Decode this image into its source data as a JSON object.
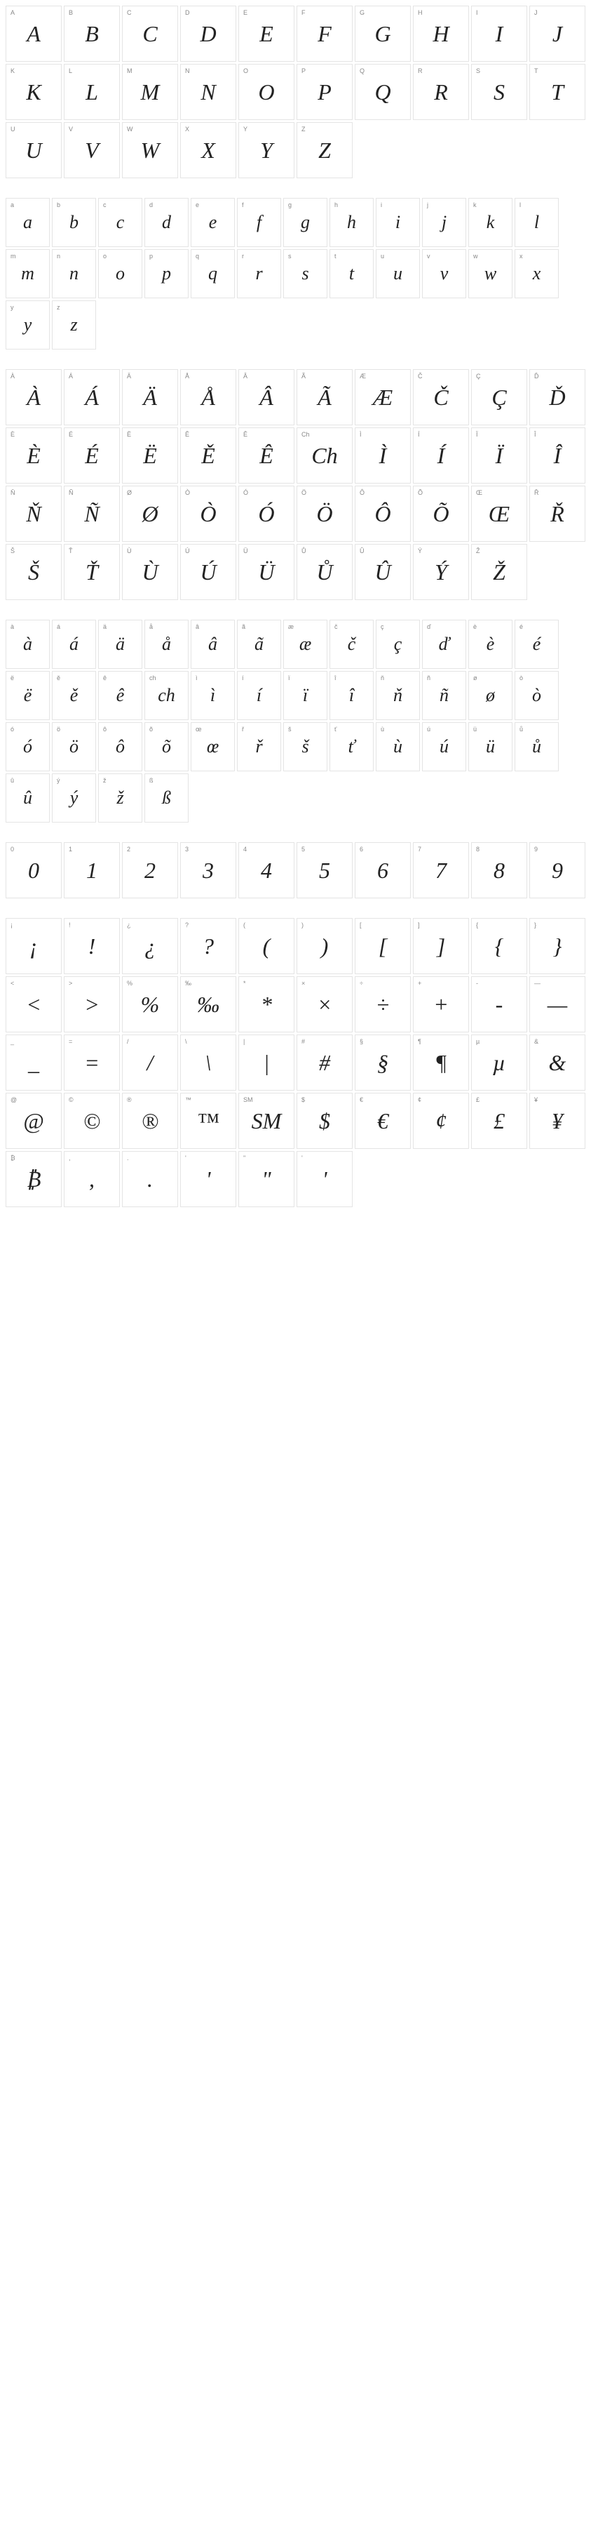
{
  "groups": [
    {
      "size": "lg",
      "cells": [
        {
          "l": "A",
          "g": "A"
        },
        {
          "l": "B",
          "g": "B"
        },
        {
          "l": "C",
          "g": "C"
        },
        {
          "l": "D",
          "g": "D"
        },
        {
          "l": "E",
          "g": "E"
        },
        {
          "l": "F",
          "g": "F"
        },
        {
          "l": "G",
          "g": "G"
        },
        {
          "l": "H",
          "g": "H"
        },
        {
          "l": "I",
          "g": "I"
        },
        {
          "l": "J",
          "g": "J"
        },
        {
          "l": "K",
          "g": "K"
        },
        {
          "l": "L",
          "g": "L"
        },
        {
          "l": "M",
          "g": "M"
        },
        {
          "l": "N",
          "g": "N"
        },
        {
          "l": "O",
          "g": "O"
        },
        {
          "l": "P",
          "g": "P"
        },
        {
          "l": "Q",
          "g": "Q"
        },
        {
          "l": "R",
          "g": "R"
        },
        {
          "l": "S",
          "g": "S"
        },
        {
          "l": "T",
          "g": "T"
        },
        {
          "l": "U",
          "g": "U"
        },
        {
          "l": "V",
          "g": "V"
        },
        {
          "l": "W",
          "g": "W"
        },
        {
          "l": "X",
          "g": "X"
        },
        {
          "l": "Y",
          "g": "Y"
        },
        {
          "l": "Z",
          "g": "Z"
        }
      ]
    },
    {
      "size": "sm",
      "cells": [
        {
          "l": "a",
          "g": "a"
        },
        {
          "l": "b",
          "g": "b"
        },
        {
          "l": "c",
          "g": "c"
        },
        {
          "l": "d",
          "g": "d"
        },
        {
          "l": "e",
          "g": "e"
        },
        {
          "l": "f",
          "g": "f"
        },
        {
          "l": "g",
          "g": "g"
        },
        {
          "l": "h",
          "g": "h"
        },
        {
          "l": "i",
          "g": "i"
        },
        {
          "l": "j",
          "g": "j"
        },
        {
          "l": "k",
          "g": "k"
        },
        {
          "l": "l",
          "g": "l"
        },
        {
          "l": "m",
          "g": "m"
        },
        {
          "l": "n",
          "g": "n"
        },
        {
          "l": "o",
          "g": "o"
        },
        {
          "l": "p",
          "g": "p"
        },
        {
          "l": "q",
          "g": "q"
        },
        {
          "l": "r",
          "g": "r"
        },
        {
          "l": "s",
          "g": "s"
        },
        {
          "l": "t",
          "g": "t"
        },
        {
          "l": "u",
          "g": "u"
        },
        {
          "l": "v",
          "g": "v"
        },
        {
          "l": "w",
          "g": "w"
        },
        {
          "l": "x",
          "g": "x"
        },
        {
          "l": "y",
          "g": "y"
        },
        {
          "l": "z",
          "g": "z"
        }
      ]
    },
    {
      "size": "lg",
      "cells": [
        {
          "l": "À",
          "g": "À"
        },
        {
          "l": "Á",
          "g": "Á"
        },
        {
          "l": "Ä",
          "g": "Ä"
        },
        {
          "l": "Å",
          "g": "Å"
        },
        {
          "l": "Â",
          "g": "Â"
        },
        {
          "l": "Ã",
          "g": "Ã"
        },
        {
          "l": "Æ",
          "g": "Æ"
        },
        {
          "l": "Č",
          "g": "Č"
        },
        {
          "l": "Ç",
          "g": "Ç"
        },
        {
          "l": "Ď",
          "g": "Ď"
        },
        {
          "l": "È",
          "g": "È"
        },
        {
          "l": "É",
          "g": "É"
        },
        {
          "l": "Ë",
          "g": "Ë"
        },
        {
          "l": "Ě",
          "g": "Ě"
        },
        {
          "l": "Ê",
          "g": "Ê"
        },
        {
          "l": "Ch",
          "g": "Ch"
        },
        {
          "l": "Ì",
          "g": "Ì"
        },
        {
          "l": "Í",
          "g": "Í"
        },
        {
          "l": "Ï",
          "g": "Ï"
        },
        {
          "l": "Î",
          "g": "Î"
        },
        {
          "l": "Ň",
          "g": "Ň"
        },
        {
          "l": "Ñ",
          "g": "Ñ"
        },
        {
          "l": "Ø",
          "g": "Ø"
        },
        {
          "l": "Ò",
          "g": "Ò"
        },
        {
          "l": "Ó",
          "g": "Ó"
        },
        {
          "l": "Ö",
          "g": "Ö"
        },
        {
          "l": "Ô",
          "g": "Ô"
        },
        {
          "l": "Õ",
          "g": "Õ"
        },
        {
          "l": "Œ",
          "g": "Œ"
        },
        {
          "l": "Ř",
          "g": "Ř"
        },
        {
          "l": "Š",
          "g": "Š"
        },
        {
          "l": "Ť",
          "g": "Ť"
        },
        {
          "l": "Ù",
          "g": "Ù"
        },
        {
          "l": "Ú",
          "g": "Ú"
        },
        {
          "l": "Ü",
          "g": "Ü"
        },
        {
          "l": "Ů",
          "g": "Ů"
        },
        {
          "l": "Û",
          "g": "Û"
        },
        {
          "l": "Ý",
          "g": "Ý"
        },
        {
          "l": "Ž",
          "g": "Ž"
        }
      ]
    },
    {
      "size": "sm",
      "cells": [
        {
          "l": "à",
          "g": "à"
        },
        {
          "l": "á",
          "g": "á"
        },
        {
          "l": "ä",
          "g": "ä"
        },
        {
          "l": "å",
          "g": "å"
        },
        {
          "l": "â",
          "g": "â"
        },
        {
          "l": "ã",
          "g": "ã"
        },
        {
          "l": "æ",
          "g": "æ"
        },
        {
          "l": "č",
          "g": "č"
        },
        {
          "l": "ç",
          "g": "ç"
        },
        {
          "l": "ď",
          "g": "ď"
        },
        {
          "l": "è",
          "g": "è"
        },
        {
          "l": "é",
          "g": "é"
        },
        {
          "l": "ë",
          "g": "ë"
        },
        {
          "l": "ě",
          "g": "ě"
        },
        {
          "l": "ê",
          "g": "ê"
        },
        {
          "l": "ch",
          "g": "ch"
        },
        {
          "l": "ì",
          "g": "ì"
        },
        {
          "l": "í",
          "g": "í"
        },
        {
          "l": "ï",
          "g": "ï"
        },
        {
          "l": "î",
          "g": "î"
        },
        {
          "l": "ň",
          "g": "ň"
        },
        {
          "l": "ñ",
          "g": "ñ"
        },
        {
          "l": "ø",
          "g": "ø"
        },
        {
          "l": "ò",
          "g": "ò"
        },
        {
          "l": "ó",
          "g": "ó"
        },
        {
          "l": "ö",
          "g": "ö"
        },
        {
          "l": "ô",
          "g": "ô"
        },
        {
          "l": "õ",
          "g": "õ"
        },
        {
          "l": "œ",
          "g": "œ"
        },
        {
          "l": "ř",
          "g": "ř"
        },
        {
          "l": "š",
          "g": "š"
        },
        {
          "l": "ť",
          "g": "ť"
        },
        {
          "l": "ù",
          "g": "ù"
        },
        {
          "l": "ú",
          "g": "ú"
        },
        {
          "l": "ü",
          "g": "ü"
        },
        {
          "l": "ů",
          "g": "ů"
        },
        {
          "l": "û",
          "g": "û"
        },
        {
          "l": "ý",
          "g": "ý"
        },
        {
          "l": "ž",
          "g": "ž"
        },
        {
          "l": "ß",
          "g": "ß"
        }
      ]
    },
    {
      "size": "lg",
      "cells": [
        {
          "l": "0",
          "g": "0"
        },
        {
          "l": "1",
          "g": "1"
        },
        {
          "l": "2",
          "g": "2"
        },
        {
          "l": "3",
          "g": "3"
        },
        {
          "l": "4",
          "g": "4"
        },
        {
          "l": "5",
          "g": "5"
        },
        {
          "l": "6",
          "g": "6"
        },
        {
          "l": "7",
          "g": "7"
        },
        {
          "l": "8",
          "g": "8"
        },
        {
          "l": "9",
          "g": "9"
        }
      ]
    },
    {
      "size": "lg",
      "cells": [
        {
          "l": "¡",
          "g": "¡"
        },
        {
          "l": "!",
          "g": "!"
        },
        {
          "l": "¿",
          "g": "¿"
        },
        {
          "l": "?",
          "g": "?"
        },
        {
          "l": "(",
          "g": "("
        },
        {
          "l": ")",
          "g": ")"
        },
        {
          "l": "[",
          "g": "["
        },
        {
          "l": "]",
          "g": "]"
        },
        {
          "l": "{",
          "g": "{"
        },
        {
          "l": "}",
          "g": "}"
        },
        {
          "l": "<",
          "g": "<"
        },
        {
          "l": ">",
          "g": ">"
        },
        {
          "l": "%",
          "g": "%"
        },
        {
          "l": "‰",
          "g": "‰"
        },
        {
          "l": "*",
          "g": "*"
        },
        {
          "l": "×",
          "g": "×"
        },
        {
          "l": "÷",
          "g": "÷"
        },
        {
          "l": "+",
          "g": "+"
        },
        {
          "l": "-",
          "g": "-"
        },
        {
          "l": "—",
          "g": "—"
        },
        {
          "l": "_",
          "g": "_"
        },
        {
          "l": "=",
          "g": "="
        },
        {
          "l": "/",
          "g": "/"
        },
        {
          "l": "\\",
          "g": "\\"
        },
        {
          "l": "|",
          "g": "|"
        },
        {
          "l": "#",
          "g": "#"
        },
        {
          "l": "§",
          "g": "§"
        },
        {
          "l": "¶",
          "g": "¶"
        },
        {
          "l": "µ",
          "g": "µ"
        },
        {
          "l": "&",
          "g": "&"
        },
        {
          "l": "@",
          "g": "@"
        },
        {
          "l": "©",
          "g": "©"
        },
        {
          "l": "®",
          "g": "®"
        },
        {
          "l": "™",
          "g": "™"
        },
        {
          "l": "SM",
          "g": "SM"
        },
        {
          "l": "$",
          "g": "$"
        },
        {
          "l": "€",
          "g": "€"
        },
        {
          "l": "¢",
          "g": "¢"
        },
        {
          "l": "£",
          "g": "£"
        },
        {
          "l": "¥",
          "g": "¥"
        },
        {
          "l": "₿",
          "g": "₿"
        },
        {
          "l": ",",
          "g": ","
        },
        {
          "l": ".",
          "g": "."
        },
        {
          "l": "'",
          "g": "'"
        },
        {
          "l": "\"",
          "g": "\""
        },
        {
          "l": "'",
          "g": "'"
        }
      ]
    }
  ]
}
